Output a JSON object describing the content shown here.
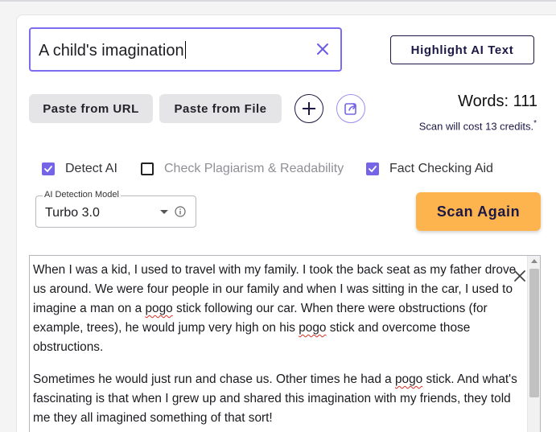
{
  "document": {
    "title_value": "A child's imagination"
  },
  "toolbar": {
    "highlight_label": "Highlight AI Text",
    "paste_url_label": "Paste from URL",
    "paste_file_label": "Paste from File"
  },
  "stats": {
    "words_label": "Words: 111",
    "cost_text": "Scan will cost 13 credits.",
    "cost_marker": "*"
  },
  "options": [
    {
      "label": "Detect AI",
      "checked": true
    },
    {
      "label": "Check Plagiarism & Readability",
      "checked": false
    },
    {
      "label": "Fact Checking Aid",
      "checked": true
    }
  ],
  "model": {
    "legend": "AI Detection Model",
    "value": "Turbo 3.0"
  },
  "scan": {
    "label": "Scan Again"
  },
  "content": {
    "p1_a": "When I was a kid, I used to travel with my family. I took the back seat as my father drove us around. We were four people in our family and when I was sitting in the car, I used to imagine a man on a ",
    "p1_w1": "pogo",
    "p1_b": " stick following our car. When there were obstructions (for example, trees), he would jump very high on his ",
    "p1_w2": "pogo",
    "p1_c": " stick and overcome those obstructions.",
    "p2_a": "Sometimes he would just run and chase us. Other times he had a ",
    "p2_w1": "pogo",
    "p2_b": " stick. And what's fascinating is that when I grew up and shared this imagination with my friends, they told me they all imagined something of that sort!"
  },
  "colors": {
    "accent": "#7565e6",
    "navy": "#1c1845",
    "scan_button": "#fdb44e"
  }
}
